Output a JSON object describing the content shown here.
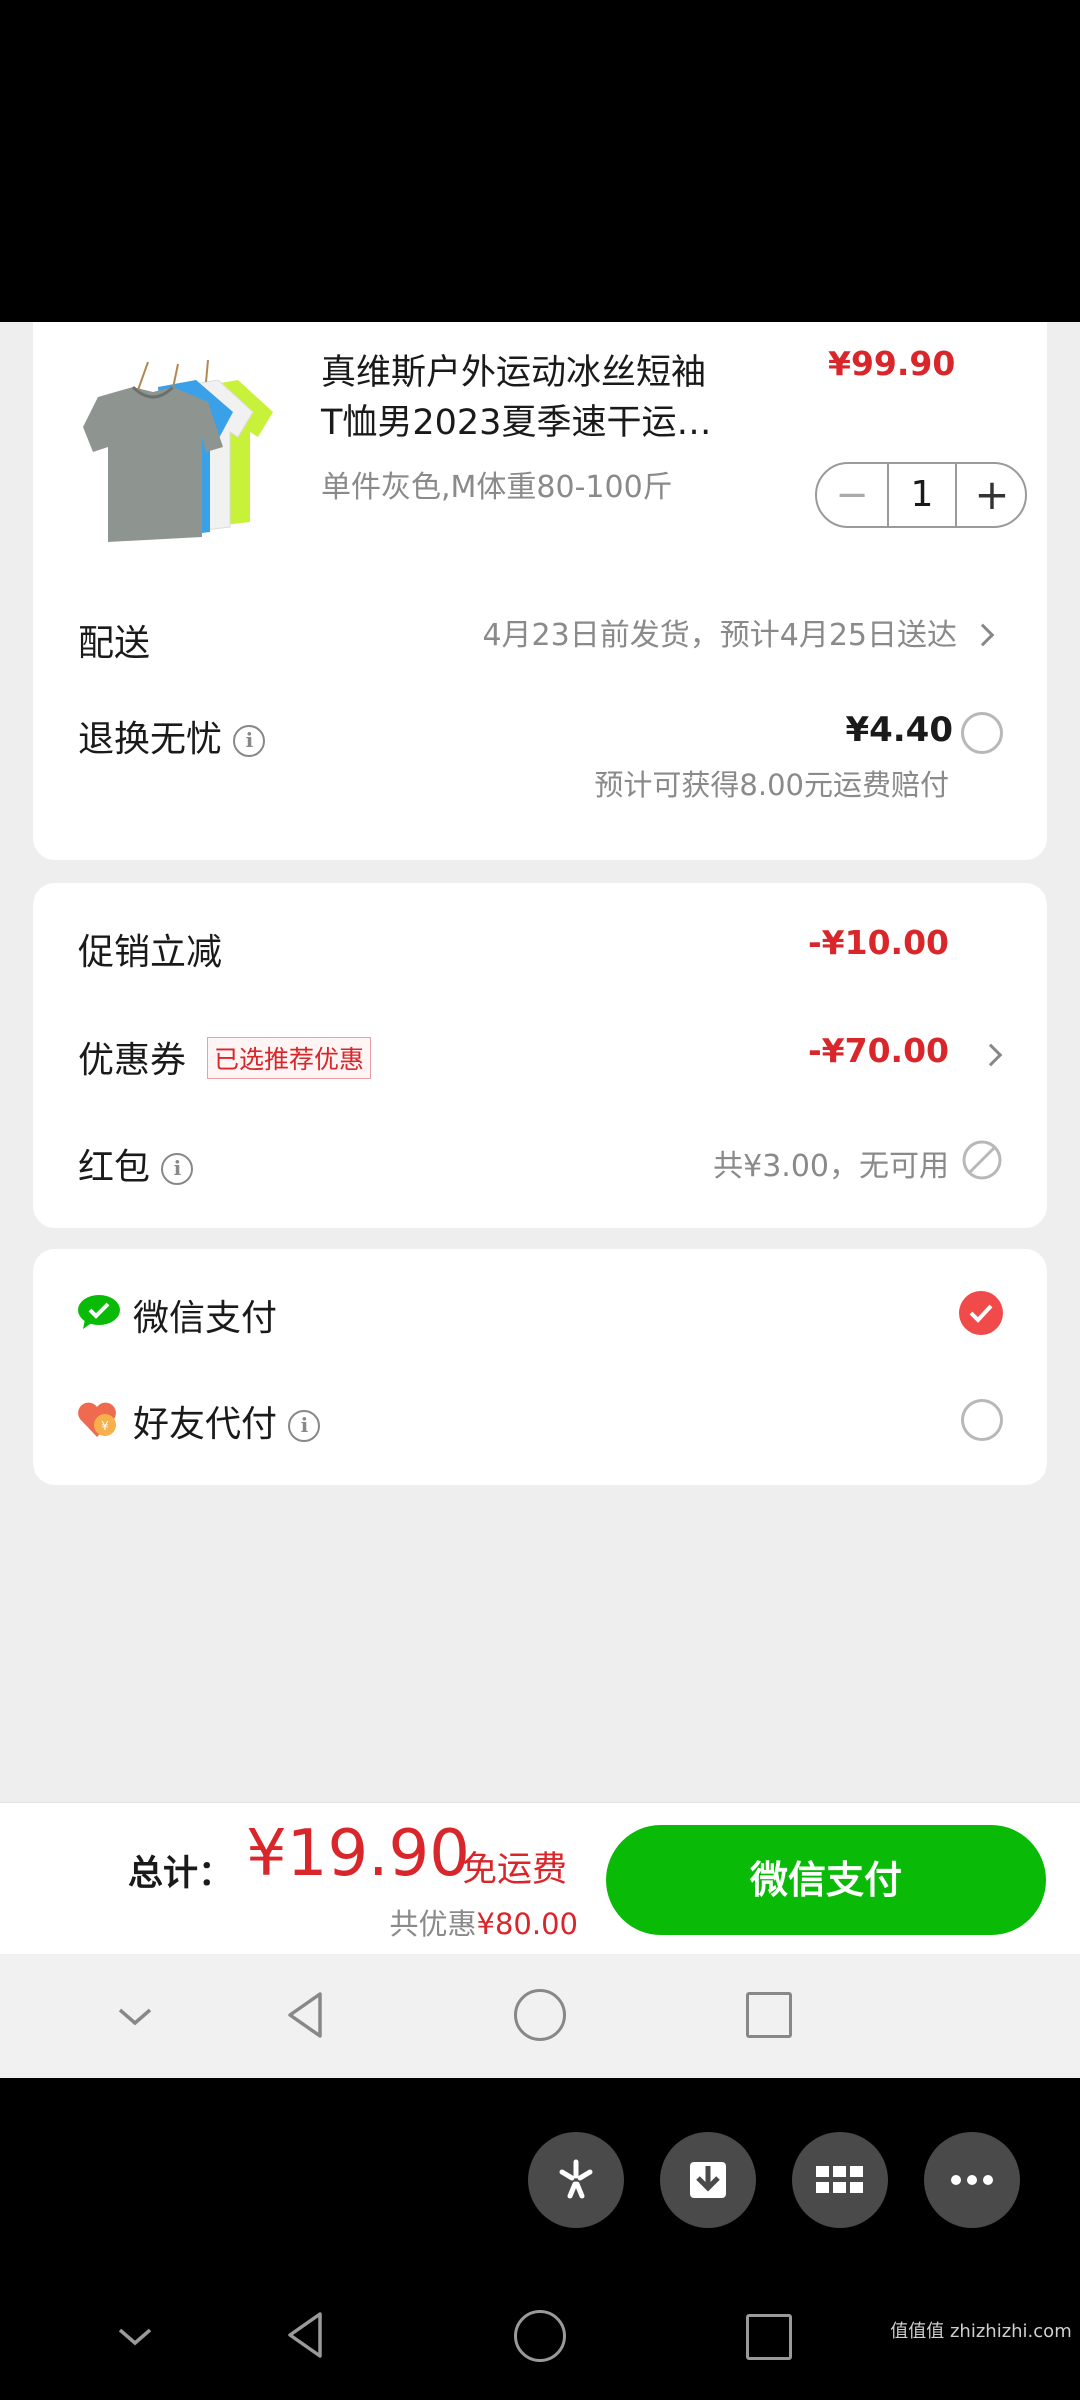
{
  "product": {
    "title_line1": "真维斯户外运动冰丝短袖",
    "title_line2": "T恤男2023夏季速干运…",
    "variant": "单件灰色,M体重80-100斤",
    "price": "¥99.90",
    "quantity": "1"
  },
  "delivery": {
    "label": "配送",
    "value": "4月23日前发货，预计4月25日送达"
  },
  "return_insurance": {
    "label": "退换无忧",
    "price": "¥4.40",
    "note": "预计可获得8.00元运费赔付"
  },
  "discounts": {
    "promo_label": "促销立减",
    "promo_value": "-¥10.00",
    "coupon_label": "优惠券",
    "coupon_tag": "已选推荐优惠",
    "coupon_value": "-¥70.00",
    "redpacket_label": "红包",
    "redpacket_value": "共¥3.00，无可用"
  },
  "payment": {
    "wechat_label": "微信支付",
    "friend_label": "好友代付"
  },
  "footer": {
    "total_label": "总计：",
    "total_value": "¥19.90",
    "shipping_note": "免运费",
    "saving_label": "共优惠",
    "saving_value": "¥80.00",
    "pay_button": "微信支付"
  },
  "watermark": "值值值 zhizhizhi.com",
  "colors": {
    "price_red": "#d9262a",
    "wechat_green": "#09bb07",
    "check_red": "#f04a4a"
  }
}
